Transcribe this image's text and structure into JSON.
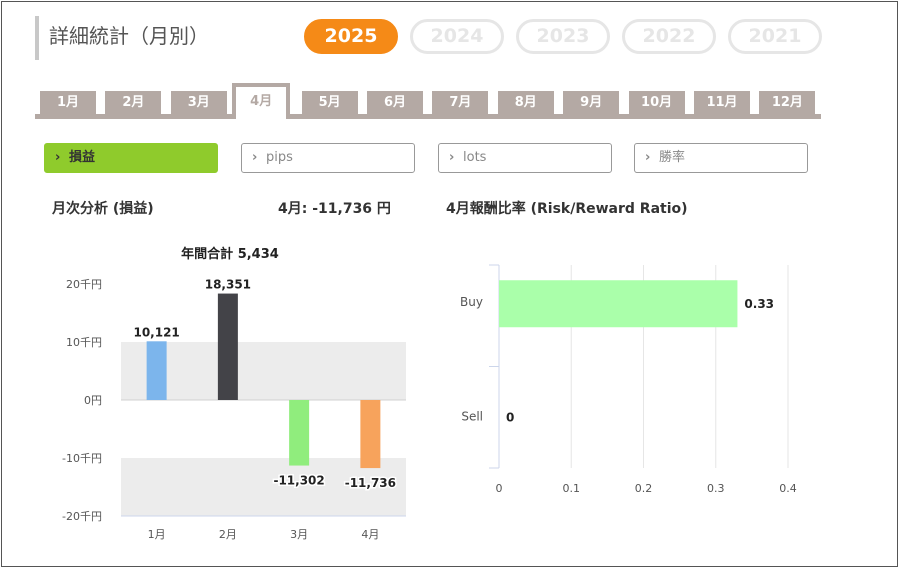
{
  "title": "詳細統計（月別）",
  "years": [
    {
      "label": "2025",
      "active": true
    },
    {
      "label": "2024",
      "active": false
    },
    {
      "label": "2023",
      "active": false
    },
    {
      "label": "2022",
      "active": false
    },
    {
      "label": "2021",
      "active": false
    }
  ],
  "months": [
    "1月",
    "2月",
    "3月",
    "4月",
    "5月",
    "6月",
    "7月",
    "8月",
    "9月",
    "10月",
    "11月",
    "12月"
  ],
  "active_month": 3,
  "metrics": [
    {
      "label": "損益",
      "active": true
    },
    {
      "label": "pips",
      "active": false
    },
    {
      "label": "lots",
      "active": false
    },
    {
      "label": "勝率",
      "active": false
    }
  ],
  "monthly_title": "月次分析 (損益)",
  "monthly_value": "4月:  -11,736 円",
  "ratio_title": "4月報酬比率 (Risk/Reward Ratio)",
  "colors": {
    "accent": "#f58a17",
    "metric_active": "#8fcb2c",
    "tab": "#b4a9a4",
    "bar_jan": "#7cb5ec",
    "bar_feb": "#434348",
    "bar_mar": "#90ed7d",
    "bar_apr": "#f7a35c",
    "bar_buy": "#aaffaa"
  },
  "chart_data": [
    {
      "type": "bar",
      "title": "年間合計 5,434",
      "categories": [
        "1月",
        "2月",
        "3月",
        "4月"
      ],
      "values": [
        10121,
        18351,
        -11302,
        -11736
      ],
      "data_labels": [
        "10,121",
        "18,351",
        "-11,302",
        "-11,736"
      ],
      "bar_colors": [
        "#7cb5ec",
        "#434348",
        "#90ed7d",
        "#f7a35c"
      ],
      "ylim": [
        -20000,
        20000
      ],
      "yticks": [
        20000,
        10000,
        0,
        -10000,
        -20000
      ],
      "ytick_labels": [
        "20千円",
        "10千円",
        "0円",
        "-10千円",
        "-20千円"
      ],
      "xlabel": "",
      "ylabel": "",
      "alternate_bands": true
    },
    {
      "type": "bar",
      "orientation": "horizontal",
      "title": "",
      "categories": [
        "Buy",
        "Sell"
      ],
      "values": [
        0.33,
        0
      ],
      "data_labels": [
        "0.33",
        "0"
      ],
      "xlim": [
        0,
        0.4
      ],
      "xticks": [
        0,
        0.1,
        0.2,
        0.3,
        0.4
      ],
      "xtick_labels": [
        "0",
        "0.1",
        "0.2",
        "0.3",
        "0.4"
      ],
      "grid": true
    }
  ]
}
